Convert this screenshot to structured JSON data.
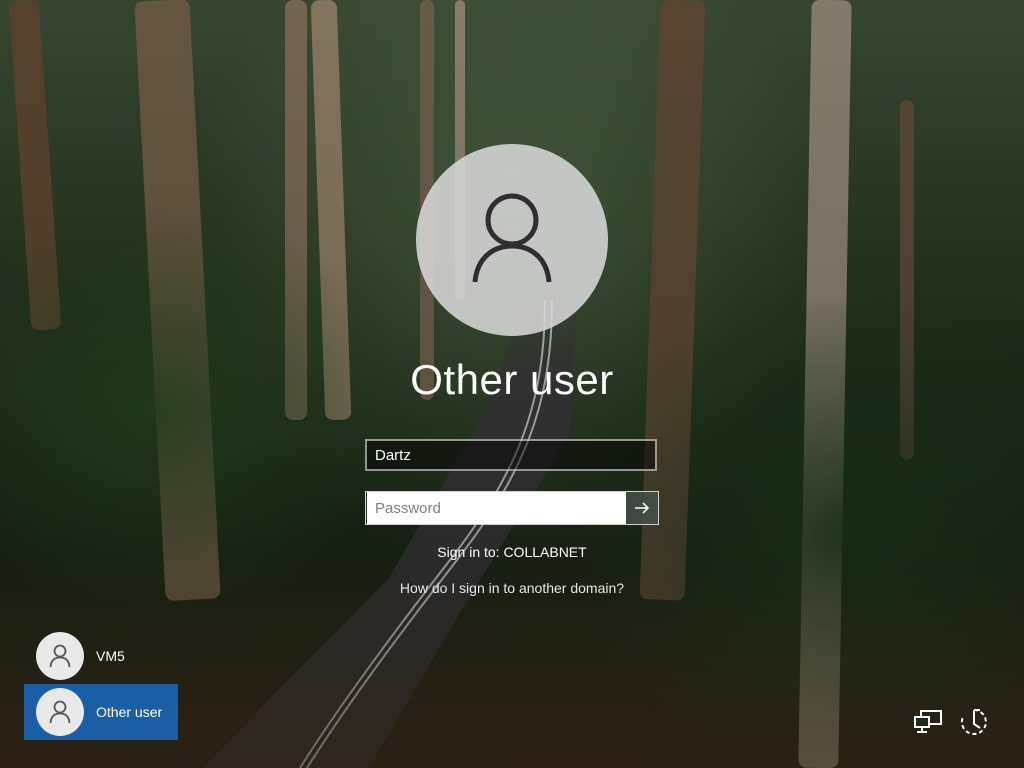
{
  "login": {
    "user_title": "Other user",
    "username_value": "Dartz",
    "password_placeholder": "Password",
    "sign_in_to": "Sign in to: COLLABNET",
    "domain_help_link": "How do I sign in to another domain?"
  },
  "user_list": [
    {
      "label": "VM5",
      "selected": false
    },
    {
      "label": "Other user",
      "selected": true
    }
  ],
  "icons": {
    "avatar": "user-icon",
    "submit": "arrow-right-icon",
    "network": "network-icon",
    "accessibility": "ease-of-access-icon"
  },
  "colors": {
    "selected_tile": "#1a5fa6",
    "avatar_bg": "#d7d7d7"
  }
}
